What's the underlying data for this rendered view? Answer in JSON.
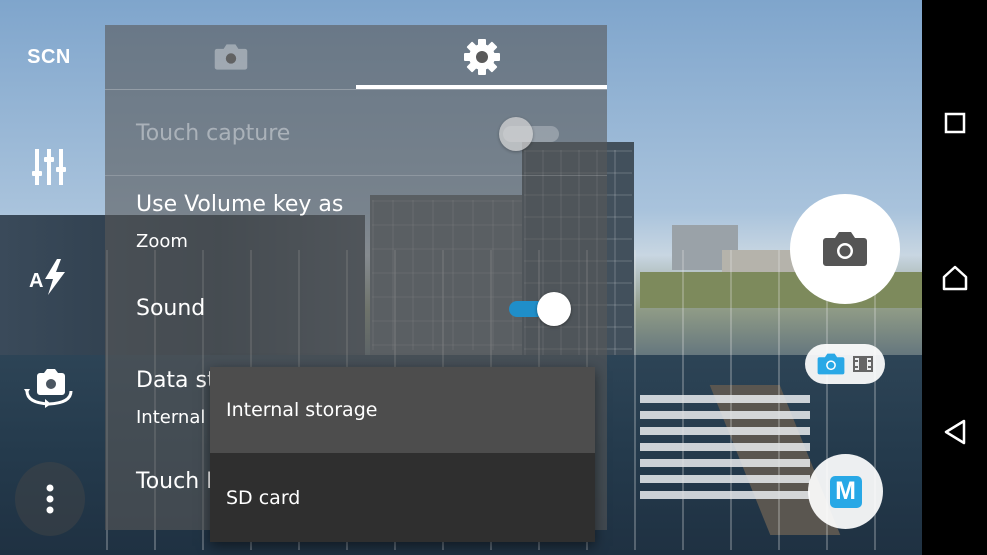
{
  "left_tools": {
    "scene_label": "SCN",
    "scene_icon": "scene-selection",
    "adjust_icon": "sliders-icon",
    "flash_icon": "auto-flash-icon",
    "flash_letter": "A",
    "front_camera_icon": "switch-camera-icon",
    "more_icon": "more-vertical-icon"
  },
  "settings": {
    "tabs": [
      {
        "icon": "camera-icon",
        "selected": false
      },
      {
        "icon": "gear-icon",
        "selected": true
      }
    ],
    "touch_capture": {
      "label": "Touch capture",
      "enabled": false,
      "on": false
    },
    "volume_key": {
      "label": "Use Volume key as",
      "value": "Zoom"
    },
    "sound": {
      "label": "Sound",
      "on": true
    },
    "data_storage": {
      "label": "Data storage",
      "value": "Internal storage"
    },
    "touch_block": {
      "label": "Touch Block"
    }
  },
  "storage_popup": {
    "options": [
      "Internal storage",
      "SD card"
    ],
    "selected": "Internal storage"
  },
  "capture": {
    "shutter_icon": "camera-icon",
    "mode_switch": {
      "photo_icon": "camera-icon",
      "video_icon": "film-icon",
      "active": "photo"
    },
    "manual_label": "M"
  },
  "navbar": {
    "recents_icon": "square-icon",
    "home_icon": "home-icon",
    "back_icon": "back-triangle-icon"
  },
  "colors": {
    "accent": "#29a8e6",
    "toggle_track_on": "#1f8ec9",
    "toggle_thumb_on": "#ffffff",
    "toggle_thumb_off": "#d9d9d9"
  }
}
